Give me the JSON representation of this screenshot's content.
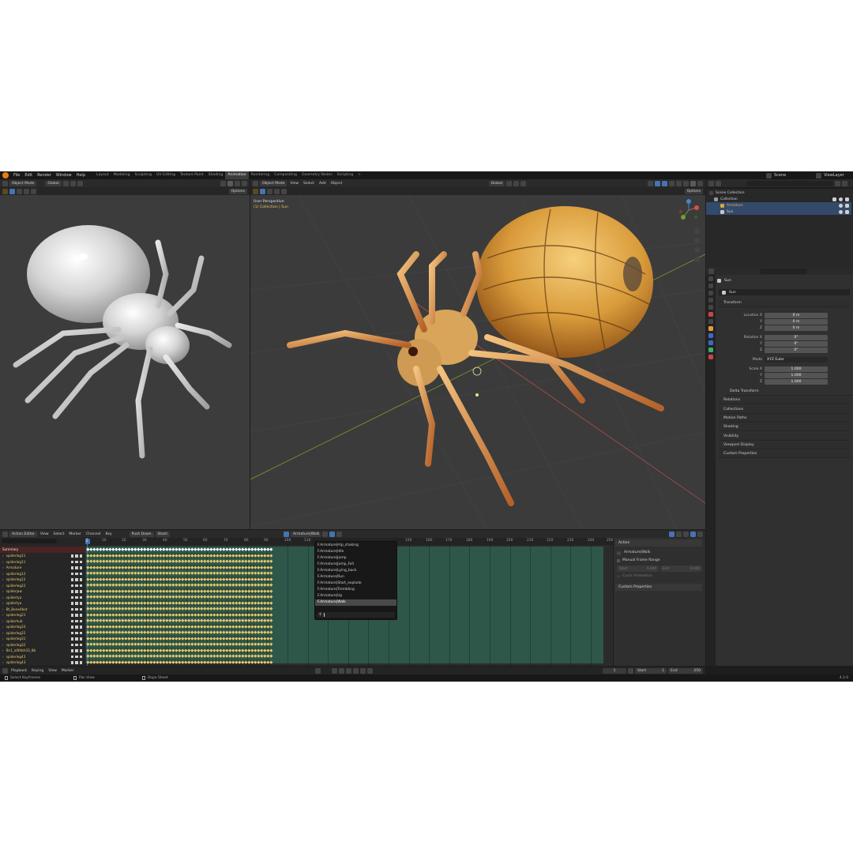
{
  "topbar": {
    "menus": [
      "File",
      "Edit",
      "Render",
      "Window",
      "Help"
    ],
    "workspaces": [
      "Layout",
      "Modeling",
      "Sculpting",
      "UV Editing",
      "Texture Paint",
      "Shading",
      "Animation",
      "Rendering",
      "Compositing",
      "Geometry Nodes",
      "Scripting"
    ],
    "active_workspace": "Animation",
    "scene": "Scene",
    "view_layer": "ViewLayer"
  },
  "left_viewport": {
    "mode": "Object Mode",
    "orientation": "Global",
    "options": "Options"
  },
  "main_viewport": {
    "mode": "Object Mode",
    "menus": [
      "View",
      "Select",
      "Add",
      "Object"
    ],
    "orientation": "Global",
    "options": "Options",
    "overlay_title": "User Perspective",
    "overlay_sub": "(1) Collection | Sun"
  },
  "outliner": {
    "search_placeholder": "",
    "rows": [
      {
        "label": "Scene Collection",
        "indent": 0,
        "selected": false
      },
      {
        "label": "Collection",
        "indent": 1,
        "selected": false
      },
      {
        "label": "Armature",
        "indent": 2,
        "selected": true
      },
      {
        "label": "Sun",
        "indent": 2,
        "selected": true
      }
    ]
  },
  "properties": {
    "object_name": "Sun",
    "data_name": "Sun",
    "transform_label": "Transform",
    "fields": [
      {
        "label": "Location X",
        "value": "0 m"
      },
      {
        "label": "Y",
        "value": "0 m"
      },
      {
        "label": "Z",
        "value": "0 m"
      },
      {
        "label": "Rotation X",
        "value": "0°"
      },
      {
        "label": "Y",
        "value": "0°"
      },
      {
        "label": "Z",
        "value": "0°"
      },
      {
        "label": "Mode",
        "value": "XYZ Euler"
      },
      {
        "label": "Scale X",
        "value": "1.000"
      },
      {
        "label": "Y",
        "value": "1.000"
      },
      {
        "label": "Z",
        "value": "1.000"
      }
    ],
    "sections": [
      "Delta Transform",
      "Relations",
      "Collections",
      "Motion Paths",
      "Shading",
      "Visibility",
      "Viewport Display",
      "Custom Properties"
    ]
  },
  "action_editor": {
    "mode": "Action Editor",
    "menus": [
      "View",
      "Select",
      "Marker",
      "Channel",
      "Key"
    ],
    "push_down": "Push Down",
    "stash": "Stash",
    "action_name": "Armature|Walk",
    "current_frame_badge": "1",
    "ruler": [
      "10",
      "20",
      "30",
      "40",
      "50",
      "60",
      "70",
      "80",
      "90",
      "100",
      "110",
      "150",
      "160",
      "170",
      "180",
      "190",
      "200",
      "210",
      "220",
      "230",
      "240",
      "250"
    ],
    "summary": "Summary",
    "channels": [
      "spiderleg11",
      "spiderleg11",
      "Armature",
      "spiderleg12",
      "spiderleg12",
      "spiderleg22",
      "spiderjaw",
      "spidertya",
      "spidertya",
      "Bt_Bone4bot",
      "spiderleg21",
      "spiderhub",
      "spiderleg33",
      "spiderleg22",
      "spiderleg31",
      "spiderleg32",
      "Bn1_allthbh33_8b",
      "spiderleg43",
      "spiderleg43"
    ],
    "dropdown_items": [
      "F.Armature|Hip_shaking",
      "F.Armature|Idle",
      "F.Armature|Jump",
      "F.Armature|Jump_Fall",
      "F.Armature|Lying_back",
      "F.Armature|Run",
      "F.Armature|Start_explode",
      "F.Armature|Trembling",
      "F.Armature|Up",
      "F.Armature|Walk"
    ],
    "dropdown_selected": 9,
    "side_panel": {
      "action_header": "Action",
      "action_name": "Armature|Walk",
      "manual_range": "Manual Frame Range",
      "start_label": "Start",
      "start_value": "0.000",
      "end_label": "End",
      "end_value": "0.000",
      "cyclic": "Cyclic Animation",
      "custom_props": "Custom Properties"
    }
  },
  "timeline": {
    "menus": [
      "Playback",
      "Keying",
      "View",
      "Marker"
    ],
    "current_frame": "1",
    "start_label": "Start",
    "start_value": "1",
    "end_label": "End",
    "end_value": "250"
  },
  "statusbar": {
    "hint1": "Select Keyframes",
    "hint2": "Pan View",
    "hint3": "Dope Sheet",
    "version": "4.2.0"
  },
  "colors": {
    "bg": "#1d1d1d",
    "header": "#2a2a2a",
    "viewport": "#3b3b3b",
    "accent": "#4772b3",
    "keyframe": "#e8c66a",
    "channel_text": "#e2c96e",
    "strip": "#2f5f4f"
  }
}
